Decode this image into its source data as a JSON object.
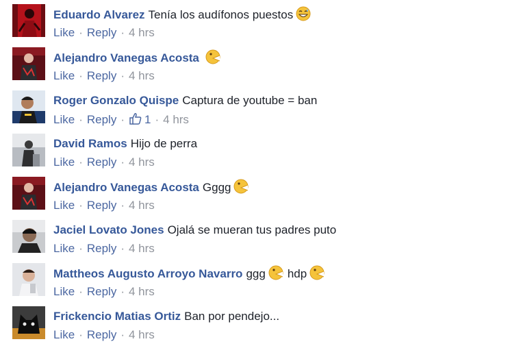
{
  "actions": {
    "like": "Like",
    "reply": "Reply"
  },
  "comments": [
    {
      "author": "Eduardo Alvarez",
      "text": "Tenía los audífonos puestos",
      "emoji": "grinning-sweat-emoji",
      "time": "4 hrs",
      "avatar": "red"
    },
    {
      "author": "Alejandro Vanegas Acosta",
      "text": "",
      "emoji": "pacman-emoji",
      "time": "4 hrs",
      "avatar": "dark-red"
    },
    {
      "author": "Roger Gonzalo Quispe",
      "text": "Captura de youtube = ban",
      "emoji": "",
      "time": "4 hrs",
      "likes": "1",
      "avatar": "blue"
    },
    {
      "author": "David Ramos",
      "text": "Hijo de perra",
      "emoji": "",
      "time": "4 hrs",
      "avatar": "gray"
    },
    {
      "author": "Alejandro Vanegas Acosta",
      "text": "Gggg",
      "emoji": "pacman-emoji",
      "time": "4 hrs",
      "avatar": "dark-red"
    },
    {
      "author": "Jaciel Lovato Jones",
      "text": "Ojalá se mueran tus padres puto",
      "emoji": "",
      "time": "4 hrs",
      "avatar": "dark-gray"
    },
    {
      "author": "Mattheos Augusto Arroyo Navarro",
      "text": "ggg",
      "emoji": "pacman-emoji",
      "text2": "hdp",
      "emoji2": "pacman-emoji",
      "time": "4 hrs",
      "avatar": "light"
    },
    {
      "author": "Frickencio Matias Ortiz",
      "text": "Ban por pendejo...",
      "emoji": "",
      "time": "4 hrs",
      "avatar": "black"
    }
  ]
}
